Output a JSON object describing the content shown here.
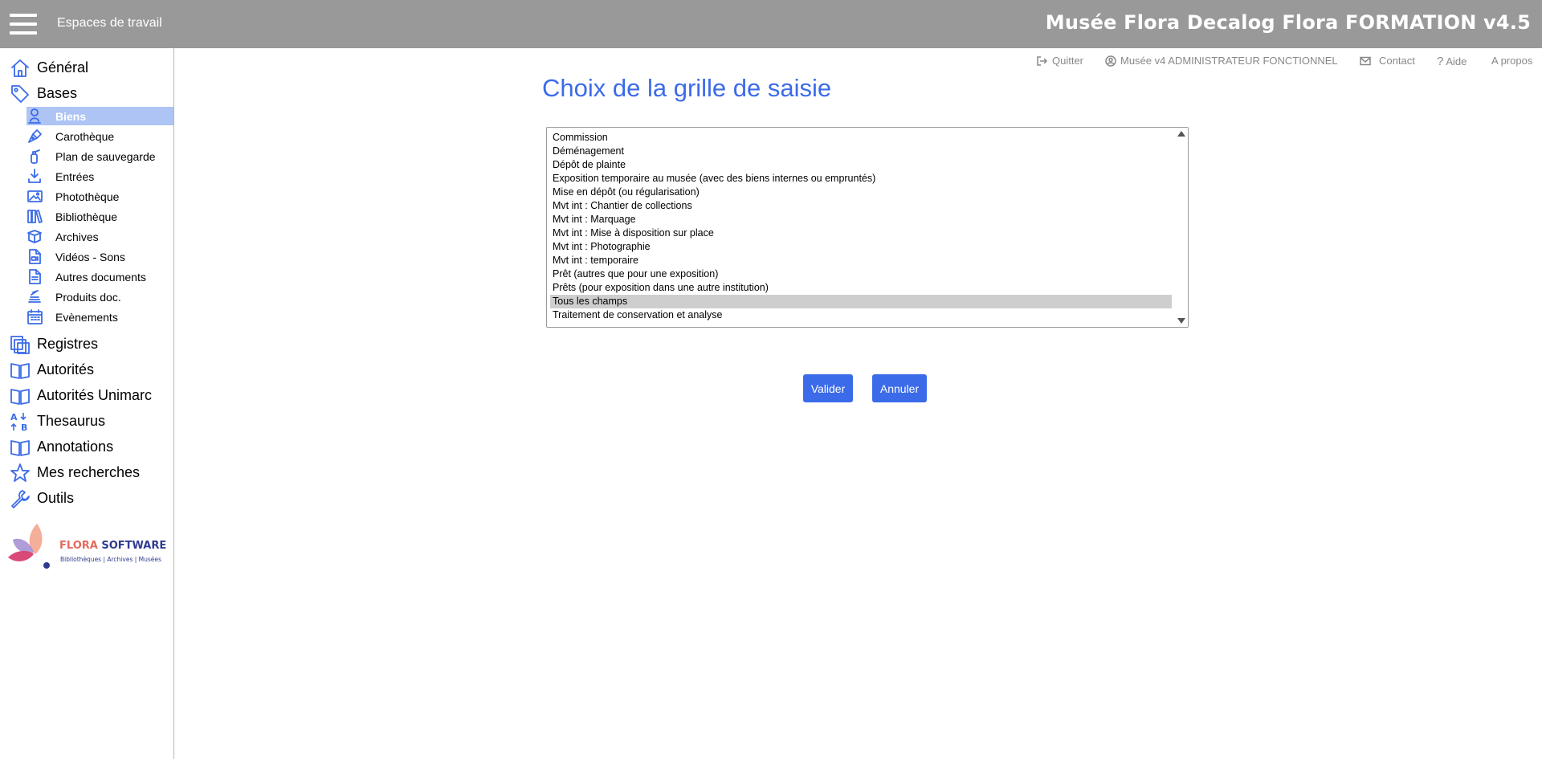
{
  "header": {
    "menu_icon": "hamburger-icon",
    "workspaces_label": "Espaces de travail",
    "app_title": "Musée Flora Decalog Flora FORMATION v4.5"
  },
  "utility": {
    "quit": "Quitter",
    "user": "Musée v4 ADMINISTRATEUR FONCTIONNEL",
    "contact": "Contact",
    "help": "Aide",
    "about": "A propos"
  },
  "sidebar": {
    "general": "Général",
    "bases": "Bases",
    "sub_items": [
      "Biens",
      "Carothèque",
      "Plan de sauvegarde",
      "Entrées",
      "Photothèque",
      "Bibliothèque",
      "Archives",
      "Vidéos - Sons",
      "Autres documents",
      "Produits doc.",
      "Evènements"
    ],
    "active_item": "Biens",
    "registres": "Registres",
    "autorites": "Autorités",
    "autorites_unimarc": "Autorités Unimarc",
    "thesaurus": "Thesaurus",
    "annotations": "Annotations",
    "mes_recherches": "Mes recherches",
    "outils": "Outils"
  },
  "logo": {
    "brand_part1": "FLORA",
    "brand_part2": "SOFTWARE",
    "tagline": "Bibliothèques | Archives | Musées",
    "colors": {
      "coral": "#e36a5d",
      "navy": "#2f3b8f",
      "pink": "#d94a78"
    }
  },
  "main": {
    "title": "Choix de la grille de saisie",
    "grids": [
      "Commission",
      "Déménagement",
      "Dépôt de plainte",
      "Exposition temporaire au musée (avec des biens internes ou empruntés)",
      "Mise en dépôt (ou régularisation)",
      "Mvt int : Chantier de collections",
      "Mvt int : Marquage",
      "Mvt int : Mise à disposition sur place",
      "Mvt int : Photographie",
      "Mvt int : temporaire",
      "Prêt (autres que pour une exposition)",
      "Prêts (pour exposition dans une autre institution)",
      "Tous les champs",
      "Traitement de conservation et analyse"
    ],
    "selected_grid": "Tous les champs",
    "validate_label": "Valider",
    "cancel_label": "Annuler"
  },
  "colors": {
    "header_bg": "#999999",
    "accent": "#3b6be8",
    "active_item_bg": "#aec4f5",
    "selected_option_bg": "#cecece"
  }
}
